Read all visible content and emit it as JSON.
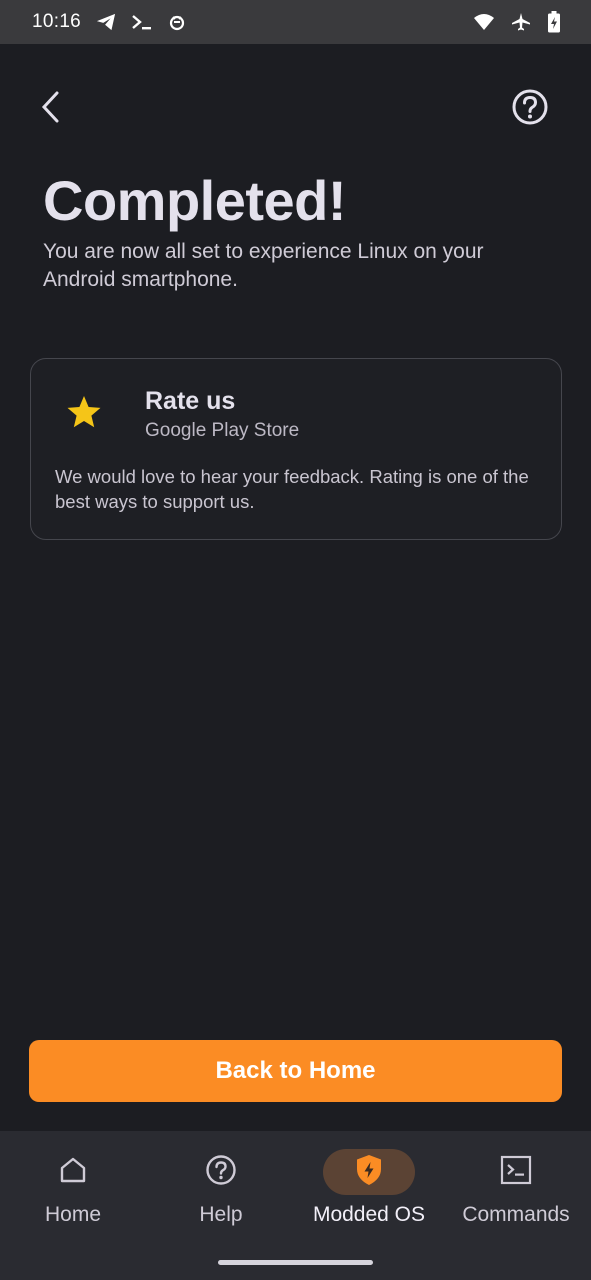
{
  "status_bar": {
    "time": "10:16",
    "left_icons": [
      "telegram-icon",
      "terminal-icon",
      "bug-icon"
    ],
    "right_icons": [
      "wifi-icon",
      "airplane-icon",
      "battery-charging-icon"
    ]
  },
  "top_bar": {
    "back_icon": "chevron-left-icon",
    "help_icon": "help-circle-icon"
  },
  "main": {
    "title": "Completed!",
    "subtitle": "You are now all set to experience Linux on your Android smartphone."
  },
  "rate_card": {
    "icon": "star-icon",
    "title": "Rate us",
    "subtitle": "Google Play Store",
    "body": "We would love to hear your feedback. Rating is one of the best ways to support us."
  },
  "cta": {
    "label": "Back to Home"
  },
  "bottom_nav": {
    "items": [
      {
        "label": "Home",
        "icon": "home-icon",
        "active": false
      },
      {
        "label": "Help",
        "icon": "help-circle-icon",
        "active": false
      },
      {
        "label": "Modded OS",
        "icon": "shield-bolt-icon",
        "active": true
      },
      {
        "label": "Commands",
        "icon": "terminal-icon",
        "active": false
      }
    ]
  },
  "colors": {
    "background": "#1c1d22",
    "accent": "#fb8c24",
    "star": "#f5c518",
    "active_pill": "#5b4334"
  }
}
